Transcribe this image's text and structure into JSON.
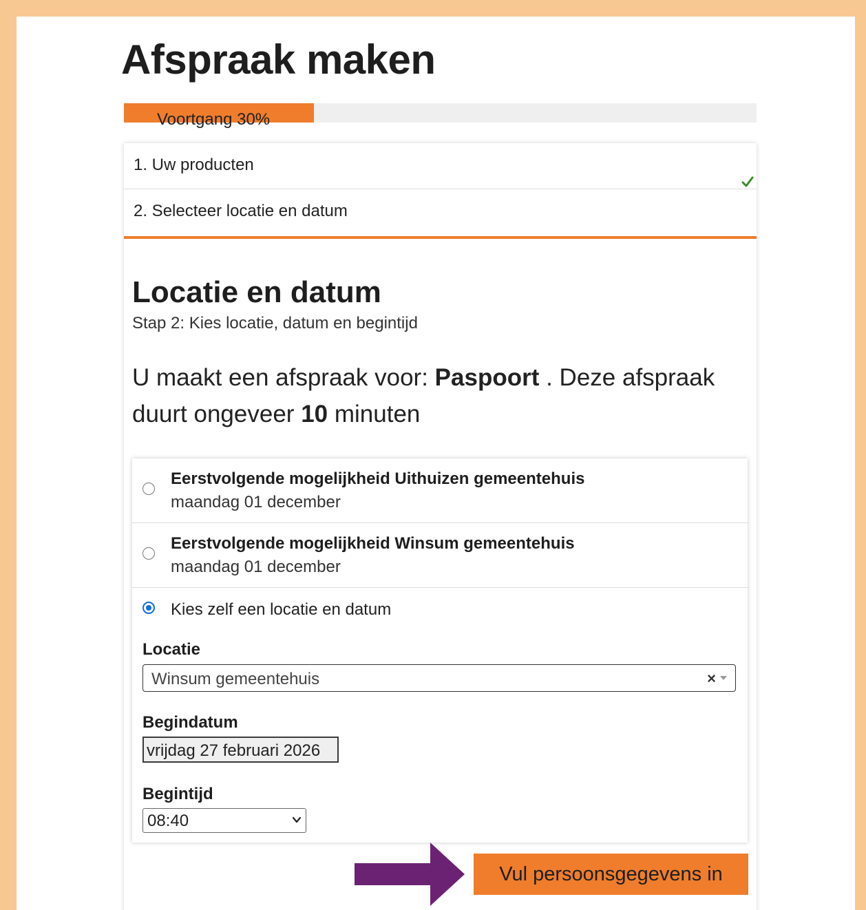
{
  "page": {
    "title": "Afspraak maken"
  },
  "progress": {
    "label": "Voortgang 30%",
    "value_percent": 30,
    "fill_color": "#ef7d2c"
  },
  "steps": [
    {
      "label": "1. Uw producten",
      "completed": true
    },
    {
      "label": "2. Selecteer locatie en datum",
      "active": true
    }
  ],
  "section": {
    "title": "Locatie en datum",
    "subtitle": "Stap 2: Kies locatie, datum en begintijd"
  },
  "summary": {
    "prefix": "U maakt een afspraak voor:",
    "product": "Paspoort",
    "middle": ". Deze afspraak duurt ongeveer",
    "duration": "10",
    "suffix": "minuten"
  },
  "options": [
    {
      "title": "Eerstvolgende mogelijkheid Uithuizen gemeentehuis",
      "date": "maandag 01 december",
      "selected": false
    },
    {
      "title": "Eerstvolgende mogelijkheid Winsum gemeentehuis",
      "date": "maandag 01 december",
      "selected": false
    },
    {
      "title": "Kies zelf een locatie en datum",
      "selected": true
    }
  ],
  "form": {
    "location_label": "Locatie",
    "location_value": "Winsum gemeentehuis",
    "clear_symbol": "×",
    "date_label": "Begindatum",
    "date_value": "vrijdag 27 februari 2026",
    "time_label": "Begintijd",
    "time_value": "08:40"
  },
  "actions": {
    "submit_label": "Vul persoonsgegevens in"
  },
  "icons": {
    "check": "check-icon",
    "arrow": "arrow-right-icon",
    "chevron": "chevron-down-icon"
  },
  "colors": {
    "accent": "#ef7d2c",
    "frame": "#f7c892",
    "arrow": "#6b2272",
    "radio": "#0b6dde",
    "check": "#3a8a2a"
  }
}
